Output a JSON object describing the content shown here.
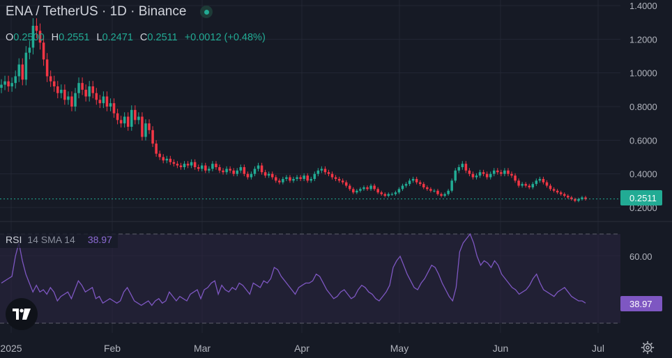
{
  "header": {
    "title": "ENA / TetherUS · 1D · Binance",
    "ohlc": {
      "o_label": "O",
      "o_value": "0.2500",
      "h_label": "H",
      "h_value": "0.2551",
      "l_label": "L",
      "l_value": "0.2471",
      "c_label": "C",
      "c_value": "0.2511",
      "change": "+0.0012 (+0.48%)"
    }
  },
  "price_axis": {
    "ticks": [
      "1.4000",
      "1.2000",
      "1.0000",
      "0.8000",
      "0.6000",
      "0.4000",
      "0.2000"
    ],
    "current_price_label": "0.2511"
  },
  "rsi": {
    "name": "RSI",
    "params": "14 SMA 14",
    "value": "38.97",
    "axis_tick": "60.00"
  },
  "time_axis": {
    "labels": [
      "2025",
      "Feb",
      "Mar",
      "Apr",
      "May",
      "Jun",
      "Jul"
    ]
  },
  "colors": {
    "background": "#161a25",
    "up": "#22ab94",
    "down": "#f23645",
    "rsi_line": "#7e57c2",
    "rsi_band": "#2a2540"
  },
  "icons": {
    "live": "live-dot-icon",
    "logo": "tradingview-logo-icon",
    "settings": "gear-icon"
  },
  "chart_data": [
    {
      "type": "candlestick",
      "title": "ENA / TetherUS · 1D · Binance",
      "x_labels": [
        "2025",
        "Feb",
        "Mar",
        "Apr",
        "May",
        "Jun",
        "Jul"
      ],
      "y_ticks": [
        1.4,
        1.2,
        1.0,
        0.8,
        0.6,
        0.4,
        0.2
      ],
      "ylim": [
        0.2,
        1.4
      ],
      "last": {
        "open": 0.25,
        "high": 0.2551,
        "low": 0.2471,
        "close": 0.2511
      },
      "close_series": [
        0.93,
        0.95,
        0.92,
        0.94,
        0.98,
        1.05,
        0.96,
        1.12,
        1.15,
        1.28,
        1.25,
        1.18,
        1.08,
        0.98,
        0.95,
        0.92,
        0.88,
        0.9,
        0.84,
        0.86,
        0.8,
        0.88,
        0.94,
        0.9,
        0.86,
        0.92,
        0.88,
        0.84,
        0.82,
        0.86,
        0.8,
        0.82,
        0.76,
        0.72,
        0.7,
        0.74,
        0.68,
        0.78,
        0.72,
        0.74,
        0.62,
        0.7,
        0.66,
        0.58,
        0.52,
        0.5,
        0.48,
        0.49,
        0.47,
        0.46,
        0.45,
        0.44,
        0.46,
        0.45,
        0.47,
        0.44,
        0.43,
        0.45,
        0.42,
        0.43,
        0.46,
        0.44,
        0.42,
        0.41,
        0.43,
        0.42,
        0.4,
        0.42,
        0.44,
        0.4,
        0.38,
        0.4,
        0.43,
        0.45,
        0.41,
        0.39,
        0.4,
        0.38,
        0.36,
        0.35,
        0.37,
        0.38,
        0.36,
        0.37,
        0.38,
        0.37,
        0.39,
        0.36,
        0.37,
        0.4,
        0.42,
        0.43,
        0.41,
        0.4,
        0.38,
        0.37,
        0.36,
        0.35,
        0.33,
        0.31,
        0.29,
        0.3,
        0.31,
        0.32,
        0.31,
        0.33,
        0.31,
        0.29,
        0.28,
        0.27,
        0.28,
        0.28,
        0.29,
        0.31,
        0.33,
        0.34,
        0.36,
        0.37,
        0.35,
        0.34,
        0.32,
        0.31,
        0.3,
        0.3,
        0.28,
        0.27,
        0.28,
        0.3,
        0.36,
        0.42,
        0.44,
        0.46,
        0.42,
        0.4,
        0.38,
        0.39,
        0.41,
        0.4,
        0.38,
        0.4,
        0.42,
        0.41,
        0.4,
        0.42,
        0.4,
        0.39,
        0.36,
        0.33,
        0.34,
        0.33,
        0.32,
        0.34,
        0.36,
        0.37,
        0.35,
        0.33,
        0.31,
        0.3,
        0.29,
        0.28,
        0.27,
        0.26,
        0.25,
        0.24,
        0.25,
        0.26,
        0.25
      ]
    },
    {
      "type": "line",
      "title": "RSI 14 SMA 14",
      "current_value": 38.97,
      "y_ticks": [
        60.0
      ],
      "band": [
        30,
        70
      ],
      "ylim": [
        25,
        75
      ],
      "values": [
        48,
        49,
        50,
        51,
        60,
        66,
        58,
        52,
        48,
        44,
        47,
        44,
        45,
        43,
        46,
        44,
        40,
        42,
        43,
        44,
        41,
        45,
        49,
        47,
        44,
        45,
        46,
        41,
        42,
        39,
        40,
        41,
        40,
        39,
        40,
        44,
        46,
        43,
        40,
        39,
        38,
        39,
        40,
        38,
        40,
        41,
        39,
        40,
        44,
        42,
        40,
        42,
        41,
        40,
        43,
        44,
        45,
        41,
        45,
        46,
        48,
        49,
        43,
        47,
        45,
        44,
        46,
        45,
        48,
        47,
        45,
        43,
        48,
        47,
        46,
        49,
        48,
        50,
        55,
        54,
        51,
        49,
        47,
        45,
        43,
        46,
        47,
        48,
        48,
        49,
        52,
        51,
        48,
        45,
        43,
        41,
        42,
        44,
        45,
        43,
        41,
        42,
        45,
        47,
        46,
        44,
        43,
        41,
        40,
        42,
        44,
        47,
        55,
        58,
        60,
        56,
        52,
        49,
        46,
        45,
        48,
        50,
        53,
        56,
        55,
        52,
        48,
        45,
        42,
        40,
        46,
        62,
        66,
        68,
        70,
        66,
        60,
        56,
        58,
        57,
        55,
        58,
        56,
        52,
        50,
        48,
        46,
        45,
        43,
        44,
        45,
        47,
        50,
        52,
        48,
        45,
        44,
        43,
        42,
        44,
        45,
        46,
        44,
        42,
        41,
        40,
        40,
        39
      ]
    }
  ]
}
